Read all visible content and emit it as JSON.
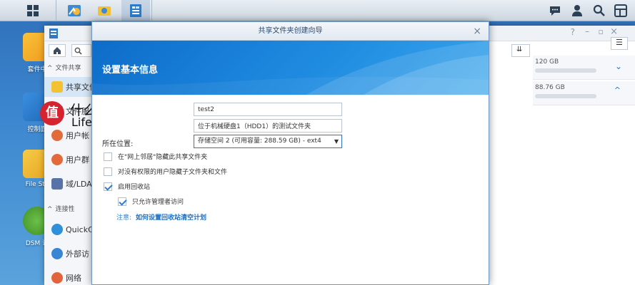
{
  "desktop": {
    "icons": [
      {
        "label": "套件中"
      },
      {
        "label": "控制面"
      },
      {
        "label": "File Sta"
      },
      {
        "label": "DSM 说"
      }
    ]
  },
  "control_panel": {
    "sidebar": {
      "section_file_sharing": "文件共享",
      "section_connectivity": "连接性",
      "items": [
        {
          "label": "共享文件"
        },
        {
          "label": "文件服"
        },
        {
          "label": "用户帐"
        },
        {
          "label": "用户群"
        },
        {
          "label": "域/LDA"
        },
        {
          "label": "QuickC"
        },
        {
          "label": "外部访"
        },
        {
          "label": "网络"
        }
      ]
    },
    "volumes": [
      {
        "size": "120 GB"
      },
      {
        "size": "88.76 GB"
      }
    ]
  },
  "wizard": {
    "title": "共享文件夹创建向导",
    "banner_heading": "设置基本信息",
    "form": {
      "name_value": "test2",
      "description_value": "位于机械硬盘1（HDD1）的测试文件夹",
      "location_label": "所在位置:",
      "location_value": "存储空间 2 (可用容量:  288.59 GB) - ext4"
    },
    "options": [
      {
        "label": "在\"网上邻居\"隐藏此共享文件夹",
        "checked": false
      },
      {
        "label": "对没有权限的用户隐藏子文件夹和文件",
        "checked": false
      },
      {
        "label": "启用回收站",
        "checked": true
      },
      {
        "label": "只允许管理者访问",
        "checked": true
      }
    ],
    "note_label": "注意:",
    "note_link": "如何设置回收站清空计划"
  },
  "watermark": {
    "logo_char": "值",
    "cn": "什么值得买",
    "en": "Lifeisgood"
  },
  "colors": {
    "accent": "#1f7fd6",
    "desktop": "#3b86cf",
    "watermark_red": "#d5232f"
  }
}
